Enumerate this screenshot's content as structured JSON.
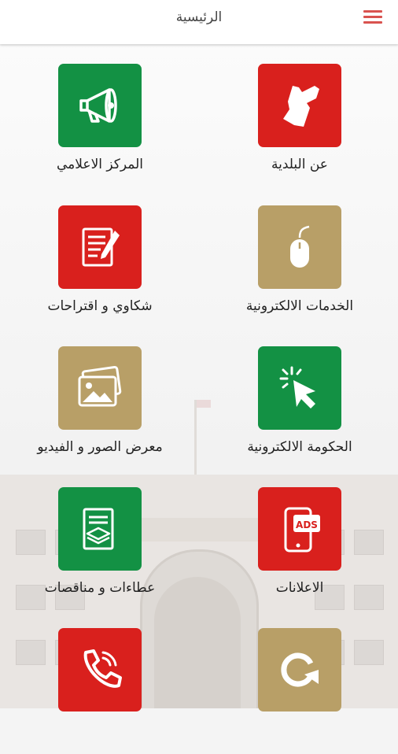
{
  "header": {
    "title": "الرئيسية",
    "menu_icon": "hamburger-menu-icon",
    "menu_color": "#d9534f"
  },
  "colors": {
    "red": "#d9201d",
    "green": "#139144",
    "gold": "#b89f67"
  },
  "tiles": [
    {
      "label": "عن البلدية",
      "icon": "jordan-map-icon",
      "color": "red"
    },
    {
      "label": "المركز الاعلامي",
      "icon": "megaphone-icon",
      "color": "green"
    },
    {
      "label": "الخدمات الالكترونية",
      "icon": "mouse-icon",
      "color": "gold"
    },
    {
      "label": "شكاوي و اقتراحات",
      "icon": "document-pen-icon",
      "color": "red"
    },
    {
      "label": "الحكومة الالكترونية",
      "icon": "cursor-click-icon",
      "color": "green"
    },
    {
      "label": "معرض الصور و الفيديو",
      "icon": "photo-gallery-icon",
      "color": "gold"
    },
    {
      "label": "الاعلانات",
      "icon": "phone-ads-icon",
      "color": "red",
      "icon_text": "ADS"
    },
    {
      "label": "عطاءات و مناقصات",
      "icon": "layers-document-icon",
      "color": "green"
    },
    {
      "label": "",
      "icon": "redo-arrow-icon",
      "color": "gold"
    },
    {
      "label": "",
      "icon": "phone-call-icon",
      "color": "red"
    }
  ]
}
